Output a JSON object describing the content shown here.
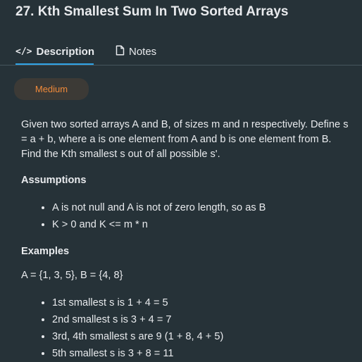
{
  "problem": {
    "title": "27. Kth Smallest Sum In Two Sorted Arrays",
    "difficulty": "Medium",
    "description": "Given two sorted arrays A and B, of sizes m and n respectively. Define s = a + b, where a is one element from A and b is one element from B. Find the Kth smallest s out of all possible s'.",
    "assumptions_heading": "Assumptions",
    "assumptions": [
      "A is not null and A is not of zero length, so as B",
      "K > 0 and K <= m * n"
    ],
    "examples_heading": "Examples",
    "example_input": "A = {1, 3, 5}, B = {4, 8}",
    "example_items": [
      "1st smallest s is 1 + 4 = 5",
      "2nd smallest s is 3 + 4 = 7",
      "3rd, 4th smallest s are 9 (1 + 8, 4 + 5)",
      "5th smallest s is 3 + 8 = 11"
    ]
  },
  "tabs": {
    "description_label": "Description",
    "description_icon": "code-icon",
    "notes_label": "Notes",
    "notes_icon": "document-icon"
  },
  "colors": {
    "background": "#263238",
    "accent": "#2fa3e6",
    "difficulty": "#f08a3a"
  }
}
